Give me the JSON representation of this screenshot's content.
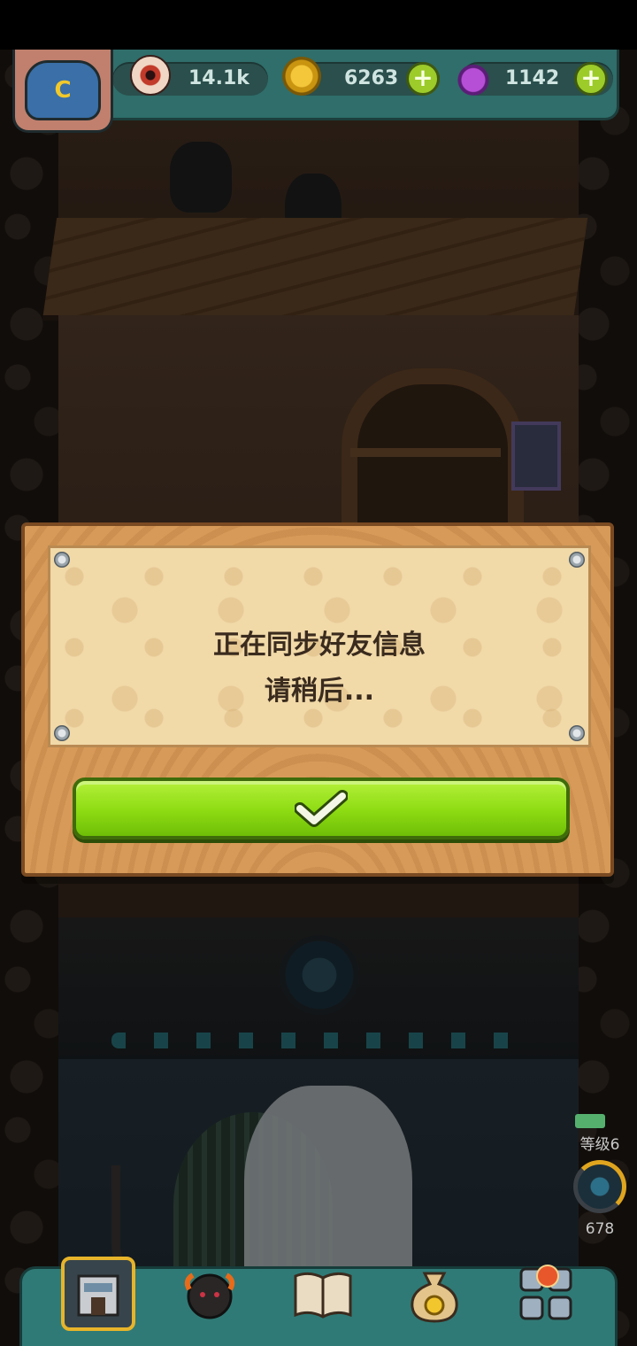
{
  "hud": {
    "eyes_value": "14.1k",
    "coins_value": "6263",
    "potions_value": "1142",
    "profile_initial": "C"
  },
  "dialog": {
    "message_line_1": "正在同步好友信息",
    "message_line_2": "请稍后..."
  },
  "level": {
    "label": "等级6",
    "count": "678"
  },
  "bottom_nav": {
    "items": [
      "tower-icon",
      "monster-icon",
      "book-icon",
      "money-bag-icon",
      "grid-icon"
    ]
  },
  "colors": {
    "confirm_green": "#8ddb12",
    "hud_teal": "#2f6e6a",
    "dialog_wood": "#d79a58",
    "parchment": "#f1d9a8",
    "level_ring": "#e0a51e"
  }
}
